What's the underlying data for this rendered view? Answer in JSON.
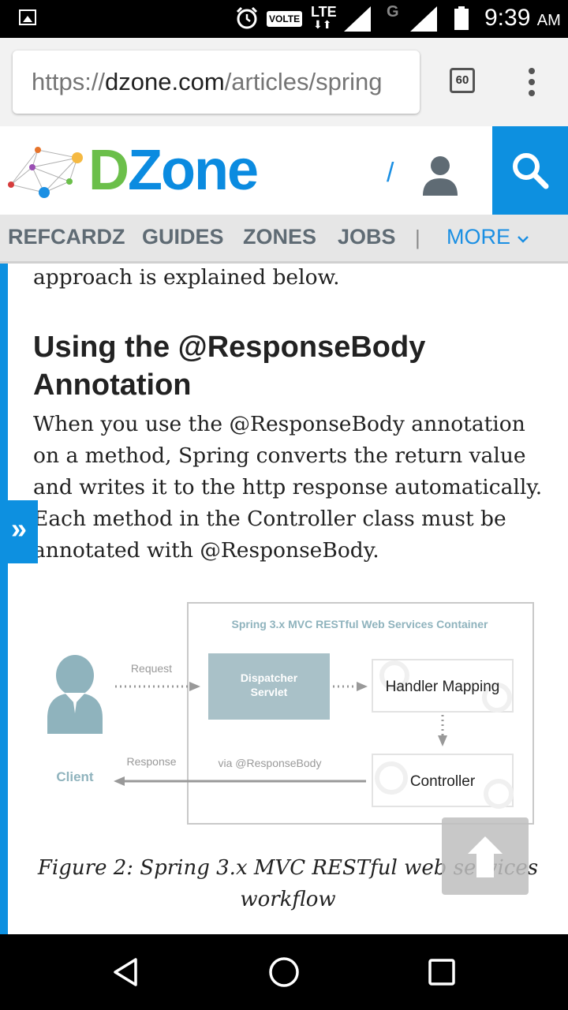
{
  "status_bar": {
    "volte": "VOLTE",
    "lte": "LTE",
    "network_g": "G",
    "time": "9:39",
    "ampm": "AM",
    "icons": [
      "gallery-icon",
      "alarm-icon",
      "signal-icon",
      "battery-icon"
    ]
  },
  "browser": {
    "url_scheme": "https://",
    "url_domain": "dzone.com",
    "url_path": "/articles/spring",
    "tab_count": "60"
  },
  "site": {
    "logo_d": "D",
    "logo_zone": "Zone",
    "slash": "/",
    "brand_color": "#0d90e0",
    "logo_green": "#6bbf4a"
  },
  "nav": {
    "items": [
      "REFCARDZ",
      "GUIDES",
      "ZONES",
      "JOBS"
    ],
    "separator": "|",
    "more": "MORE"
  },
  "article": {
    "prev_line": "approach is explained below.",
    "heading": "Using the @ResponseBody Annotation",
    "paragraph": "When you use the @ResponseBody annotation on a method, Spring converts the return value and writes it to the http response automatically. Each method in the Controller class must be annotated with @ResponseBody.",
    "side_tab": "»",
    "caption": "Figure 2: Spring 3.x MVC RESTful web services workflow"
  },
  "diagram": {
    "container_title": "Spring 3.x MVC RESTful Web Services Container",
    "request_label": "Request",
    "response_label": "Response",
    "via_label": "via @ResponseBody",
    "client_label": "Client",
    "dispatcher_line1": "Dispatcher",
    "dispatcher_line2": "Servlet",
    "handler_label": "Handler Mapping",
    "controller_label": "Controller"
  }
}
